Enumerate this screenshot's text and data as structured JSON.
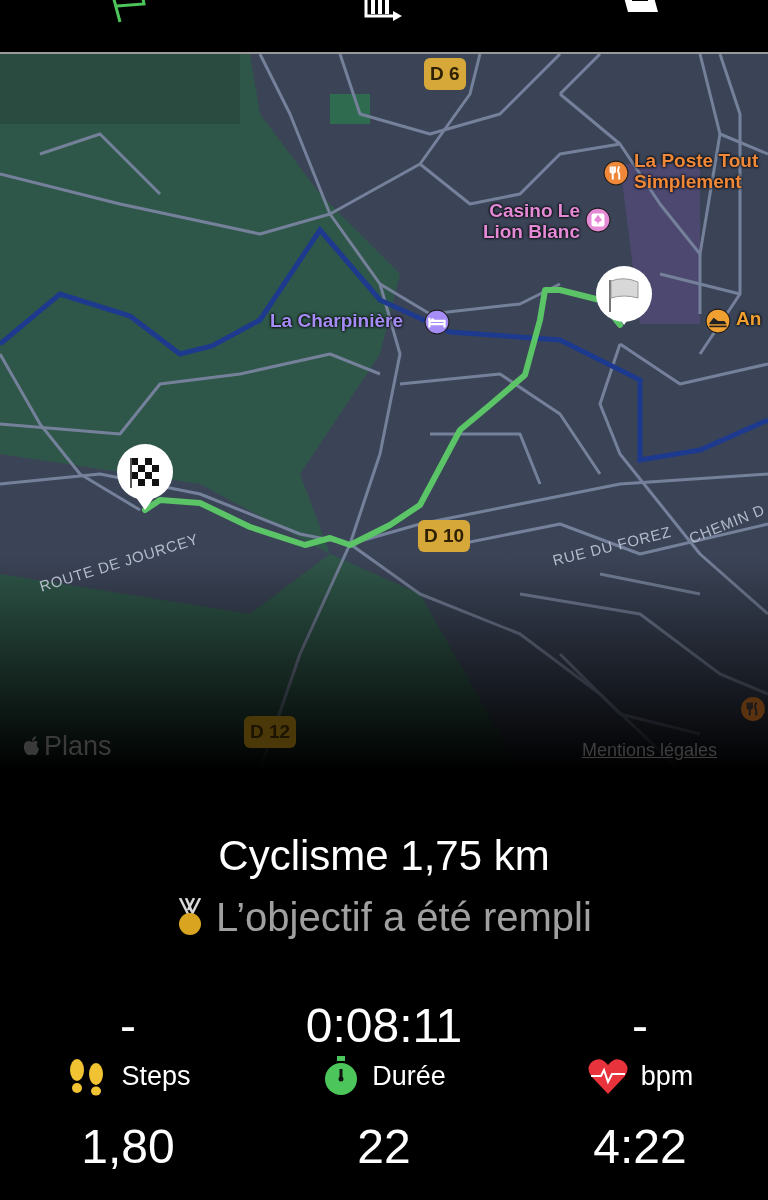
{
  "top_tabs": [
    {
      "kind": "flag",
      "selected": true
    },
    {
      "kind": "chart",
      "selected": false
    },
    {
      "kind": "document",
      "selected": false
    }
  ],
  "map": {
    "road_shields": [
      {
        "label": "D 6",
        "dimmed": false
      },
      {
        "label": "D 10",
        "dimmed": false
      },
      {
        "label": "D 12",
        "dimmed": true
      }
    ],
    "places": [
      {
        "name": "La Poste Tout Simplement",
        "kind": "restaurant",
        "color": "#f0883a"
      },
      {
        "name": "Casino Le Lion Blanc",
        "kind": "casino",
        "color": "#e58ad6"
      },
      {
        "name": "La Charpinière",
        "kind": "hotel",
        "color": "#a68cf5"
      },
      {
        "name": "An",
        "kind": "shoe",
        "color": "#f0a030"
      }
    ],
    "street_labels": [
      "ROUTE DE JOURCEY",
      "RUE DU FOREZ",
      "CHEMIN D"
    ],
    "logo": "Plans",
    "legal_link": "Mentions légales"
  },
  "summary": {
    "title": "Cyclisme 1,75 km",
    "goal": "L’objectif a été rempli"
  },
  "stats": [
    {
      "kind": "steps",
      "value": "-",
      "label": "Steps"
    },
    {
      "kind": "duration",
      "value": "0:08:11",
      "label": "Durée"
    },
    {
      "kind": "heart",
      "value": "-",
      "label": "bpm"
    }
  ],
  "stats_next_row": [
    "1,80",
    "22",
    "4:22"
  ]
}
